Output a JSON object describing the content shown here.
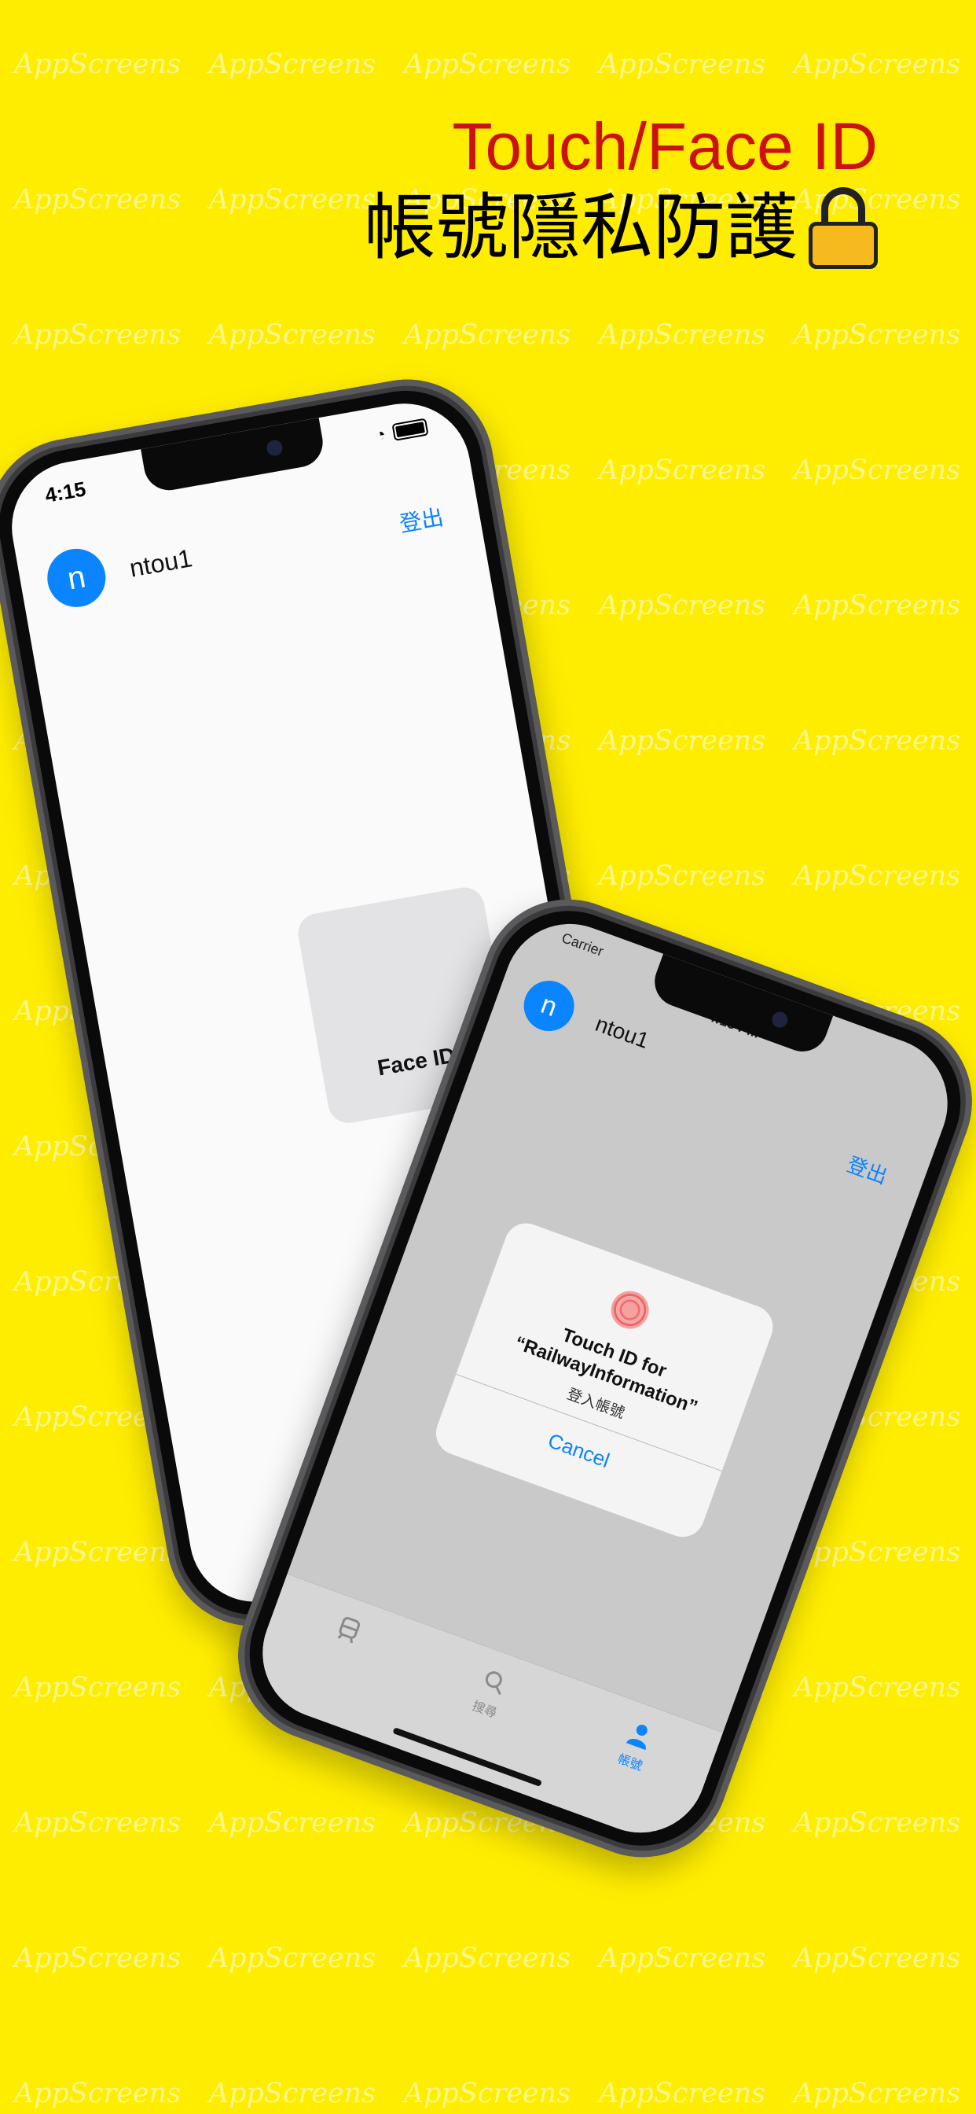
{
  "colors": {
    "background": "#FFED00",
    "headline_red": "#CC1111",
    "accent_blue": "#0A84FF",
    "lock_yellow": "#F6B91E"
  },
  "headline": {
    "line1": "Touch/Face ID",
    "line2": "帳號隱私防護",
    "icon": "lock-icon"
  },
  "watermark": "AppScreens",
  "phone_face": {
    "time": "4:15",
    "avatar_letter": "n",
    "username": "ntou1",
    "logout": "登出",
    "faceid_label": "Face ID"
  },
  "phone_touch": {
    "carrier": "Carrier",
    "time": "4:18 PM",
    "avatar_letter": "n",
    "username": "ntou1",
    "logout": "登出",
    "alert": {
      "icon": "fingerprint-icon",
      "title_line1": "Touch ID for",
      "title_line2": "“RailwayInformation”",
      "message": "登入帳號",
      "cancel": "Cancel"
    },
    "tabs": [
      {
        "label": "",
        "icon": "train-icon"
      },
      {
        "label": "搜尋",
        "icon": "search-icon"
      },
      {
        "label": "帳號",
        "icon": "person-icon"
      }
    ]
  }
}
